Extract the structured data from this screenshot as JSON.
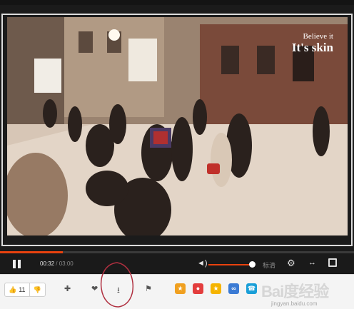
{
  "video": {
    "watermark_line1": "Believe it",
    "watermark_line2": "It's skin"
  },
  "controls": {
    "current_time": "00:32",
    "separator": " / ",
    "duration": "03:00",
    "progress_fraction": 0.178,
    "volume_fraction": 0.9,
    "quality_label": "标清",
    "accent_color": "#e8420e"
  },
  "toolbar": {
    "like_count": "11",
    "icons": [
      "thumbs-up-icon",
      "thumbs-down-icon",
      "plus-icon",
      "heart-icon",
      "download-icon",
      "flag-icon"
    ]
  },
  "overlay": {
    "baidu_logo": "Bai度经验",
    "baidu_url": "jingyan.baidu.com"
  }
}
